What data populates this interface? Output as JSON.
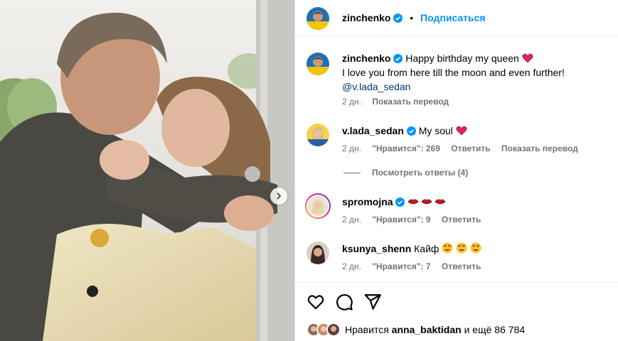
{
  "post": {
    "author": "zinchenko",
    "follow_label": "Подписаться",
    "dot": "•"
  },
  "caption": {
    "user": "zinchenko",
    "line1": "Happy birthday my queen",
    "line2": "I love you from here till the moon and even further!",
    "mention": "@v.lada_sedan",
    "time": "2 дн.",
    "translate": "Показать перевод"
  },
  "comments": [
    {
      "user": "v.lada_sedan",
      "text": "My soul",
      "time": "2 дн.",
      "likes": "\"Нравится\": 269",
      "reply": "Ответить",
      "translate": "Показать перевод",
      "view_replies": "Посмотреть ответы (4)"
    },
    {
      "user": "spromojna",
      "text": "",
      "time": "2 дн.",
      "likes": "\"Нравится\": 9",
      "reply": "Ответить"
    },
    {
      "user": "ksunya_shenn",
      "text": "Кайф",
      "time": "2 дн.",
      "likes": "\"Нравится\": 7",
      "reply": "Ответить"
    }
  ],
  "likes_bar": {
    "prefix": "Нравится",
    "user": "anna_baktidan",
    "suffix": "и ещё 86 784"
  },
  "icons": {
    "like": "heart-outline-icon",
    "comment": "speech-bubble-icon",
    "share": "paper-plane-icon",
    "verified": "verified-badge-icon",
    "next": "chevron-right-icon"
  },
  "colors": {
    "follow": "#0095f6",
    "verified": "#0095f6",
    "heart": "#e0245e",
    "meta": "#737373",
    "mention": "#00376b"
  }
}
